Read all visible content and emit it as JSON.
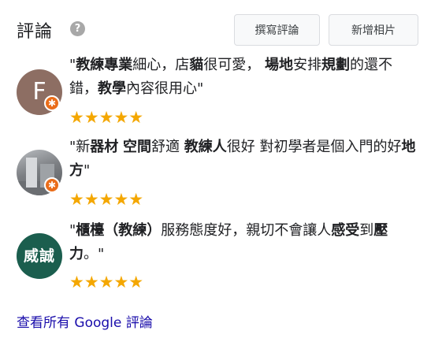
{
  "header": {
    "title": "評論",
    "help_icon": "?",
    "write_review_label": "撰寫評論",
    "add_photo_label": "新增相片"
  },
  "reviews": [
    {
      "avatar_letter": "F",
      "avatar_color": "#8d6e63",
      "local_guide_badge": true,
      "quote_parts": [
        "\"",
        "教練專業",
        "細心，店",
        "貓",
        "很可愛， ",
        "場地",
        "安排",
        "規劃",
        "的還不錯，",
        "教學",
        "內容很用心\""
      ],
      "rating": 5,
      "stars": "★★★★★"
    },
    {
      "avatar_type": "photo",
      "local_guide_badge": true,
      "quote_parts": [
        "\"新",
        "器材",
        " ",
        "空間",
        "舒適 ",
        "教練人",
        "很好 對初學者是個入門的好",
        "地方",
        "\""
      ],
      "rating": 5,
      "stars": "★★★★★"
    },
    {
      "avatar_text": "威誠",
      "avatar_color": "#1b5e4e",
      "local_guide_badge": false,
      "quote_parts": [
        "\"",
        "櫃檯（教練）",
        "服務態度好，親切不會讓人",
        "感受",
        "到",
        "壓力",
        "。\""
      ],
      "rating": 5,
      "stars": "★★★★★"
    }
  ],
  "footer": {
    "all_reviews_link": "查看所有 Google 評論"
  },
  "colors": {
    "star": "#f4a700",
    "badge": "#ea6d1a",
    "link": "#1a0dab"
  }
}
